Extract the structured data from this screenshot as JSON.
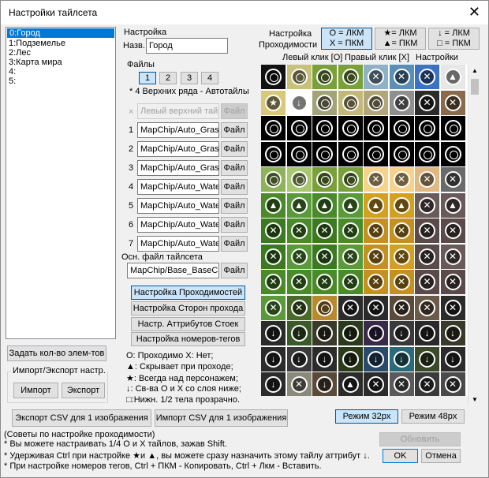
{
  "window": {
    "title": "Настройки тайлсета",
    "close_glyph": "✕"
  },
  "tileset_list": [
    "0:Город",
    "1:Подземелье",
    "2:Лес",
    "3:Карта мира",
    "4:",
    "5:"
  ],
  "set_count_button": "Задать кол-во элем-тов",
  "import_export": {
    "title": "Импорт/Экспорт настр.",
    "import": "Импорт",
    "export": "Экспорт"
  },
  "settings": {
    "label": "Настройка",
    "name_label": "Назв.",
    "name_value": "Город",
    "files_label": "Файлы",
    "file_tabs": [
      "1",
      "2",
      "3",
      "4"
    ],
    "autotile_note": "* 4 Верхних ряда - Автотайлы",
    "top_left_placeholder": "Левый верхний тай",
    "file_button": "Файл",
    "files": [
      {
        "num": "1",
        "value": "MapChip/Auto_Grass"
      },
      {
        "num": "2",
        "value": "MapChip/Auto_Grass"
      },
      {
        "num": "3",
        "value": "MapChip/Auto_Grass"
      },
      {
        "num": "4",
        "value": "MapChip/Auto_Water"
      },
      {
        "num": "5",
        "value": "MapChip/Auto_Water"
      },
      {
        "num": "6",
        "value": "MapChip/Auto_Water"
      },
      {
        "num": "7",
        "value": "MapChip/Auto_Water"
      }
    ],
    "base_file_label": "Осн. файл тайлсета",
    "base_file_value": "MapChip/Base_BaseChip",
    "mode_buttons": [
      "Настройка Проходимостей",
      "Настройка Сторон прохода",
      "Настр. Аттрибутов Стоек",
      "Настройка номеров-тегов"
    ]
  },
  "legend": {
    "line1": "O: Проходимо    X: Нет;",
    "line2": "▲: Скрывает при проходе;",
    "line3": "★: Всегда над персонажем;",
    "line4": "↓: Св-ва О и Х со слоя ниже;",
    "line5": "□:Нижн. 1/2 тела прозрачно."
  },
  "passability": {
    "label_line1": "Настройка",
    "label_line2": "Проходимости",
    "btn1_line1": "O = ЛКМ",
    "btn1_line2": "X = ПКМ",
    "btn2_line1": "★= ЛКМ",
    "btn2_line2": "▲= ПКМ",
    "btn3_line1": "↓ = ЛКМ",
    "btn3_line2": "□ = ПКМ"
  },
  "click_header": {
    "left": "Левый клик [O]",
    "right": "Правый клик [X]",
    "settings": "Настройки"
  },
  "csv": {
    "export": "Экспорт CSV для 1 изображения",
    "import": "Импорт CSV для 1 изображения"
  },
  "modes": {
    "m32": "Режим 32px",
    "m48": "Режим 48px"
  },
  "hints": {
    "title": "(Советы по настройке проходимости)",
    "h1": "* Вы можете настраивать 1/4 О и X тайлов, зажав Shift.",
    "h2": "* Удерживая Ctrl при настройке ★и ▲, вы можете сразу назначить этому тайлу аттрибут ↓.",
    "h3": "* При настройке номеров тегов, Ctrl + ПКМ - Копировать, Ctrl + Лкм - Вставить."
  },
  "buttons": {
    "update": "Обновить",
    "ok": "OK",
    "cancel": "Отмена"
  },
  "tile_rows": [
    [
      "o",
      "o",
      "o",
      "o",
      "x",
      "x",
      "x",
      "up"
    ],
    [
      "star",
      "down",
      "o",
      "o",
      "o",
      "x",
      "x",
      "x"
    ],
    [
      "o",
      "o",
      "o",
      "o",
      "o",
      "o",
      "o",
      "o"
    ],
    [
      "o",
      "o",
      "o",
      "o",
      "o",
      "o",
      "o",
      "o"
    ],
    [
      "o",
      "o",
      "o",
      "o",
      "x",
      "x",
      "x",
      "x"
    ],
    [
      "up",
      "up",
      "up",
      "up",
      "up",
      "up",
      "x",
      "up"
    ],
    [
      "x",
      "x",
      "x",
      "x",
      "x",
      "x",
      "x",
      "x"
    ],
    [
      "x",
      "x",
      "x",
      "x",
      "x",
      "x",
      "x",
      "x"
    ],
    [
      "x",
      "x",
      "x",
      "x",
      "x",
      "x",
      "x",
      "x"
    ],
    [
      "x",
      "x",
      "o",
      "x",
      "x",
      "x",
      "x",
      "x"
    ],
    [
      "down",
      "down",
      "down",
      "down",
      "down",
      "down",
      "down",
      "down"
    ],
    [
      "down",
      "down",
      "down",
      "down",
      "down",
      "down",
      "down",
      "down"
    ],
    [
      "down",
      "x",
      "down",
      "up",
      "x",
      "x",
      "x",
      "x"
    ]
  ],
  "tile_colors": [
    [
      "#111111",
      "#c9c07a",
      "#7aa03a",
      "#7aa03a",
      "#8fb1c8",
      "#5c8fb8",
      "#3a73c4",
      "#e7e7e7"
    ],
    [
      "#d8c87a",
      "#ffffff",
      "#a3a37a",
      "#c3b87a",
      "#b0a67a",
      "#8f8f8f",
      "#2b2b2b",
      "#8a6a4a"
    ],
    [
      "#000000",
      "#000000",
      "#000000",
      "#000000",
      "#000000",
      "#000000",
      "#000000",
      "#000000"
    ],
    [
      "#000000",
      "#000000",
      "#000000",
      "#000000",
      "#000000",
      "#000000",
      "#000000",
      "#000000"
    ],
    [
      "#8fb35a",
      "#a8c870",
      "#7aa03a",
      "#7aa03a",
      "#f5d38a",
      "#f5d38a",
      "#e0b880",
      "#6a6a6a"
    ],
    [
      "#4a8a2a",
      "#5a9a3a",
      "#4a8a2a",
      "#5a9a3a",
      "#d4a020",
      "#d4a020",
      "#6a5a5a",
      "#6a5a5a"
    ],
    [
      "#3c7a22",
      "#4a8a2a",
      "#3c7a22",
      "#4a8a2a",
      "#c49020",
      "#c49020",
      "#5a4a4a",
      "#5a4a4a"
    ],
    [
      "#3c7a22",
      "#5a9a3a",
      "#3c7a22",
      "#5a9a3a",
      "#c49020",
      "#d4a020",
      "#5a4a4a",
      "#6a5a5a"
    ],
    [
      "#4a8a2a",
      "#4a8a2a",
      "#4a8a2a",
      "#4a8a2a",
      "#c49020",
      "#c49020",
      "#5a4a4a",
      "#5a4a4a"
    ],
    [
      "#5a9a3a",
      "#4a6a2a",
      "#b88a30",
      "#2b2b2b",
      "#2b2b2b",
      "#5a4a3a",
      "#6a5a4a",
      "#2b2b2b"
    ],
    [
      "#2b2b2b",
      "#3a5a2a",
      "#3a3a2a",
      "#2b3a1a",
      "#3a2a4a",
      "#3a3a3a",
      "#2a2a2a",
      "#3a3a2a"
    ],
    [
      "#2b2b2b",
      "#3a3a3a",
      "#2b2b2b",
      "#2b3a1a",
      "#2a4a6a",
      "#2a6a7a",
      "#3a4a2a",
      "#2b2b2b"
    ],
    [
      "#2b2b2b",
      "#8a8a7a",
      "#5a4a3a",
      "#2b2b2b",
      "#2b2b2b",
      "#5a5a5a",
      "#3a3a3a",
      "#4a4a4a"
    ]
  ],
  "glyphs": {
    "o": "",
    "x": "✕",
    "up": "▲",
    "down": "↓",
    "star": "★"
  }
}
